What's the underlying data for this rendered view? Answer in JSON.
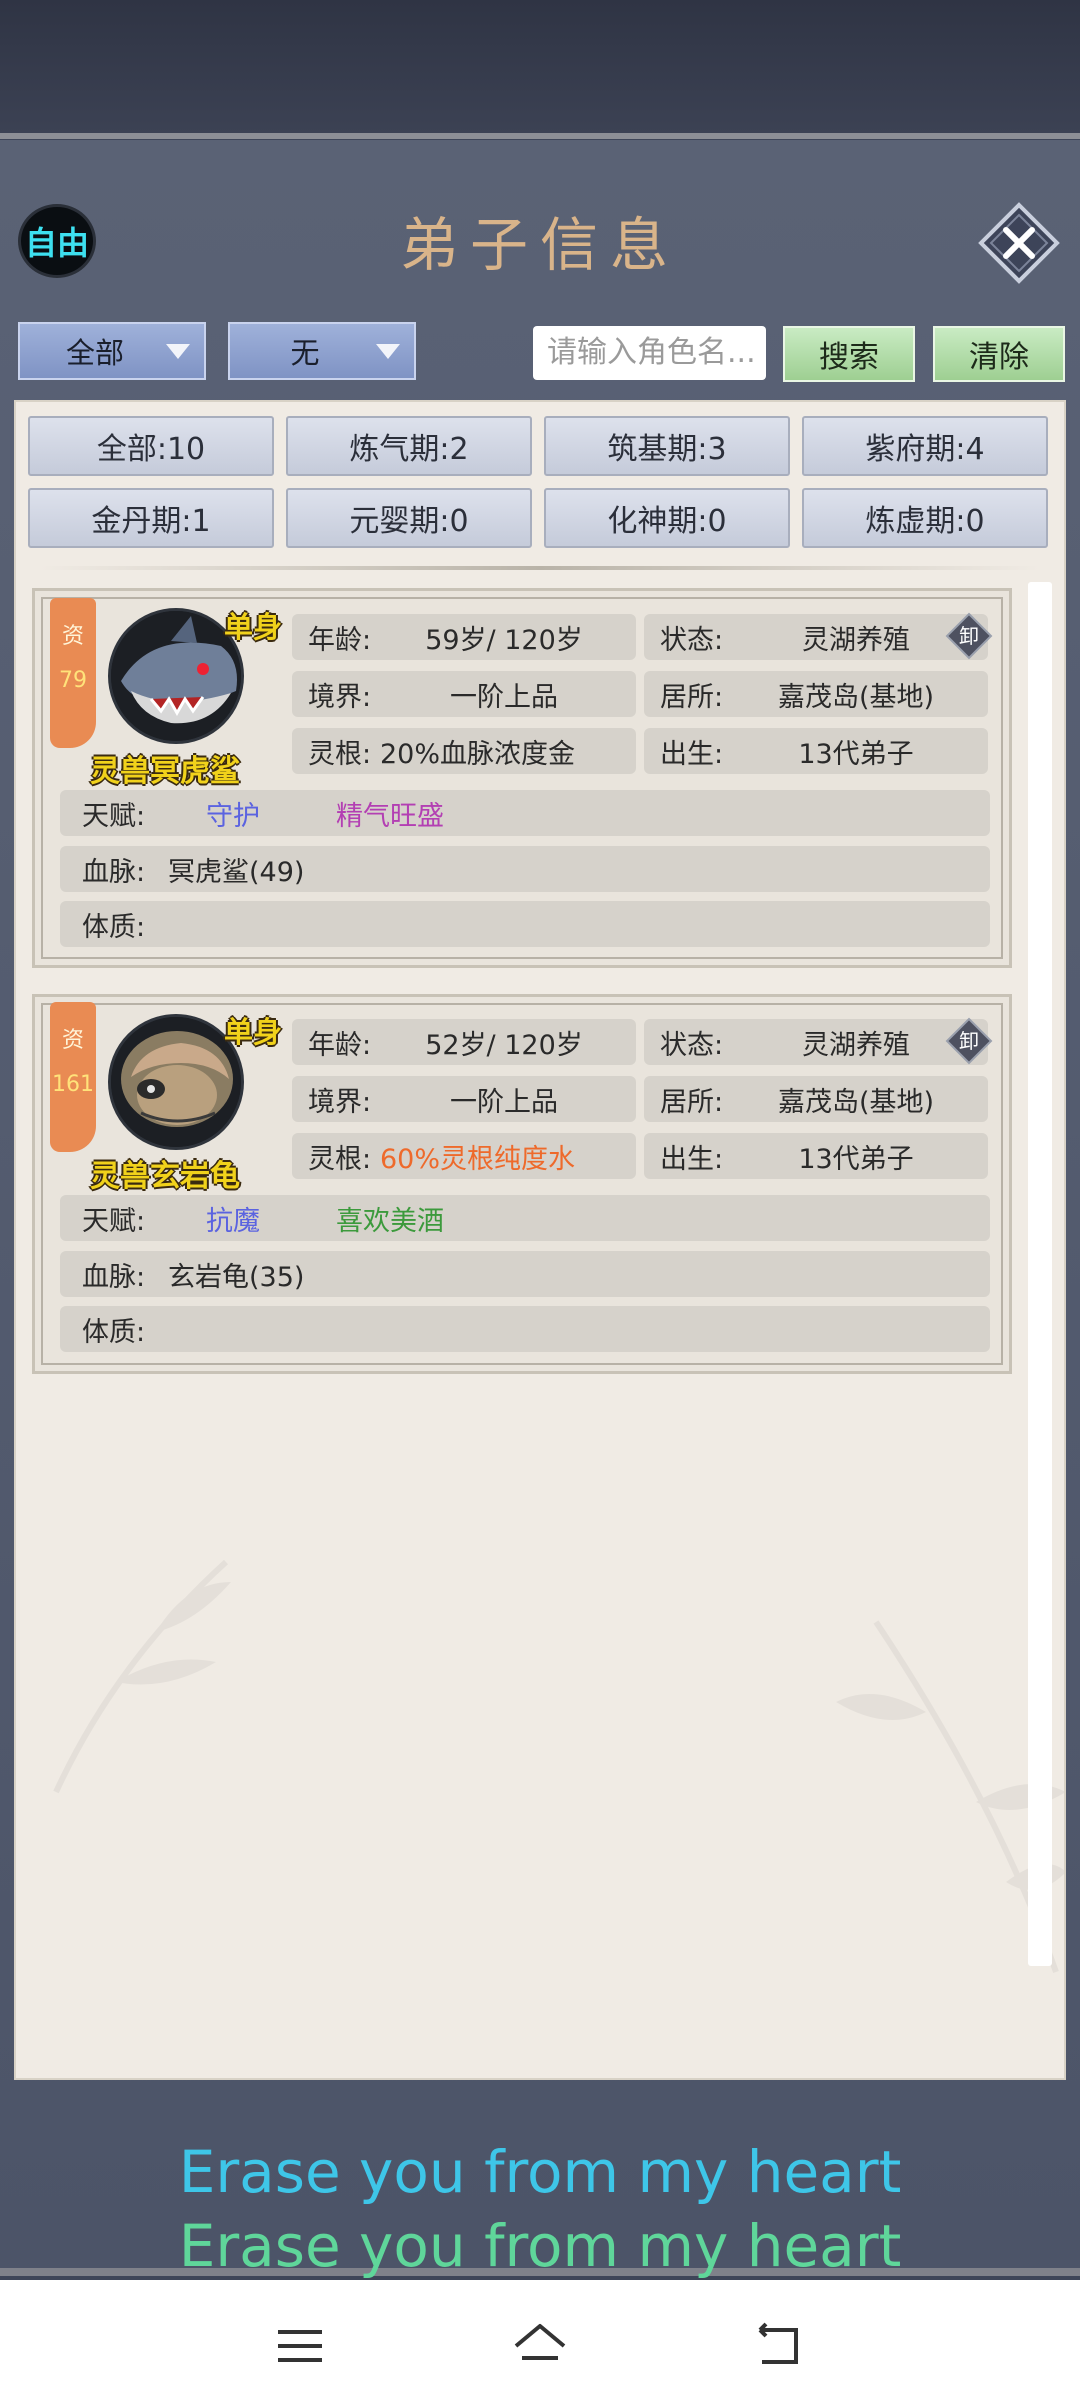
{
  "header": {
    "free_label": "自由",
    "title": "弟子信息"
  },
  "filters": {
    "dropdown1": "全部",
    "dropdown2": "无",
    "search_placeholder": "请输入角色名...",
    "search_label": "搜索",
    "clear_label": "清除"
  },
  "realm_tabs": [
    "全部:10",
    "炼气期:2",
    "筑基期:3",
    "紫府期:4",
    "金丹期:1",
    "元婴期:0",
    "化神期:0",
    "炼虚期:0"
  ],
  "cards": [
    {
      "zi_label": "资",
      "zi_value": "79",
      "tag": "单身",
      "name": "灵兽冥虎鲨",
      "age_label": "年龄:",
      "age": "59岁/ 120岁",
      "status_label": "状态:",
      "status": "灵湖养殖",
      "realm_label": "境界:",
      "realm": "一阶上品",
      "home_label": "居所:",
      "home": "嘉茂岛(基地)",
      "root_label": "灵根:",
      "root": "20%血脉浓度金",
      "birth_label": "出生:",
      "birth": "13代弟子",
      "talent_label": "天赋:",
      "talents": [
        "守护",
        "精气旺盛"
      ],
      "bloodline_label": "血脉:",
      "bloodline": "冥虎鲨(49)",
      "physique_label": "体质:",
      "physique": "",
      "unload": "卸"
    },
    {
      "zi_label": "资",
      "zi_value": "161",
      "tag": "单身",
      "name": "灵兽玄岩龟",
      "age_label": "年龄:",
      "age": "52岁/ 120岁",
      "status_label": "状态:",
      "status": "灵湖养殖",
      "realm_label": "境界:",
      "realm": "一阶上品",
      "home_label": "居所:",
      "home": "嘉茂岛(基地)",
      "root_label": "灵根:",
      "root": "60%灵根纯度水",
      "birth_label": "出生:",
      "birth": "13代弟子",
      "talent_label": "天赋:",
      "talents": [
        "抗魔",
        "喜欢美酒"
      ],
      "bloodline_label": "血脉:",
      "bloodline": "玄岩龟(35)",
      "physique_label": "体质:",
      "physique": "",
      "unload": "卸"
    }
  ],
  "lyrics": [
    "Erase you from my heart",
    "Erase you from my heart"
  ],
  "colors": {
    "talent_blue": "#5b63e0",
    "talent_purple": "#b33fb3",
    "talent_green": "#3c9a3c",
    "root_orange": "#ee6a2b",
    "lyric1": "#3ec6e8",
    "lyric2": "#5fd69a"
  },
  "nav": {
    "icons": [
      "menu-icon",
      "home-icon",
      "back-icon"
    ]
  }
}
